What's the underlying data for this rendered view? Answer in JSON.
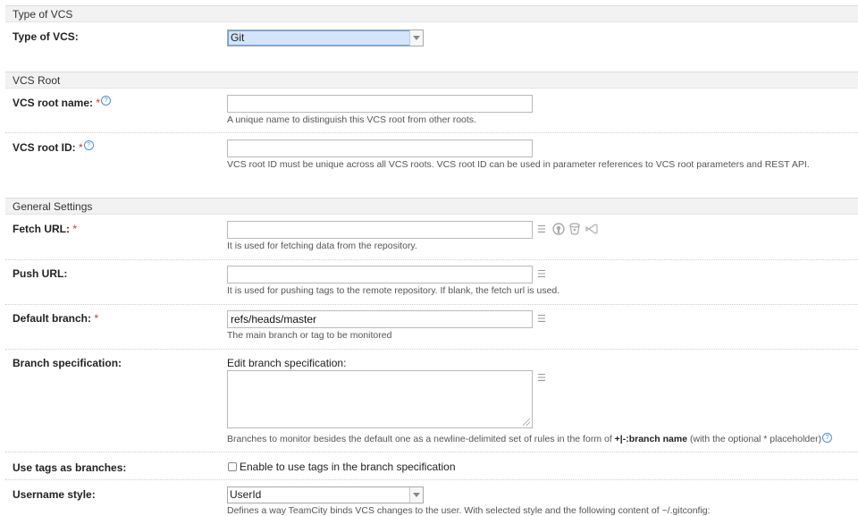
{
  "sections": {
    "type_of_vcs": "Type of VCS",
    "vcs_root": "VCS Root",
    "general_settings": "General Settings"
  },
  "fields": {
    "type_of_vcs": {
      "label": "Type of VCS:",
      "value": "Git"
    },
    "vcs_root_name": {
      "label": "VCS root name:",
      "required": "*",
      "help": "?",
      "value": "",
      "note": "A unique name to distinguish this VCS root from other roots."
    },
    "vcs_root_id": {
      "label": "VCS root ID:",
      "required": "*",
      "help": "?",
      "value": "",
      "note": "VCS root ID must be unique across all VCS roots. VCS root ID can be used in parameter references to VCS root parameters and REST API."
    },
    "fetch_url": {
      "label": "Fetch URL:",
      "required": "*",
      "value": "",
      "note": "It is used for fetching data from the repository."
    },
    "push_url": {
      "label": "Push URL:",
      "value": "",
      "note": "It is used for pushing tags to the remote repository. If blank, the fetch url is used."
    },
    "default_branch": {
      "label": "Default branch:",
      "required": "*",
      "value": "refs/heads/master",
      "note": "The main branch or tag to be monitored"
    },
    "branch_spec": {
      "label": "Branch specification:",
      "editor_label": "Edit branch specification:",
      "value": "",
      "note_prefix": "Branches to monitor besides the default one as a newline-delimited set of rules in the form of ",
      "note_bold": "+|-:branch name",
      "note_suffix": " (with the optional * placeholder)",
      "help": "?"
    },
    "use_tags": {
      "label": "Use tags as branches:",
      "checkbox_label": "Enable to use tags in the branch specification",
      "checked": false
    },
    "username_style": {
      "label": "Username style:",
      "value": "UserId",
      "note": "Defines a way TeamCity binds VCS changes to the user. With selected style and the following content of ~/.gitconfig:"
    }
  },
  "icons": {
    "list": "list-icon",
    "github": "github-icon",
    "bitbucket": "bitbucket-icon",
    "vs": "visualstudio-icon"
  },
  "colors": {
    "required": "#c0392b",
    "help": "#4a90d9",
    "section_bg": "#f2f2f2"
  }
}
